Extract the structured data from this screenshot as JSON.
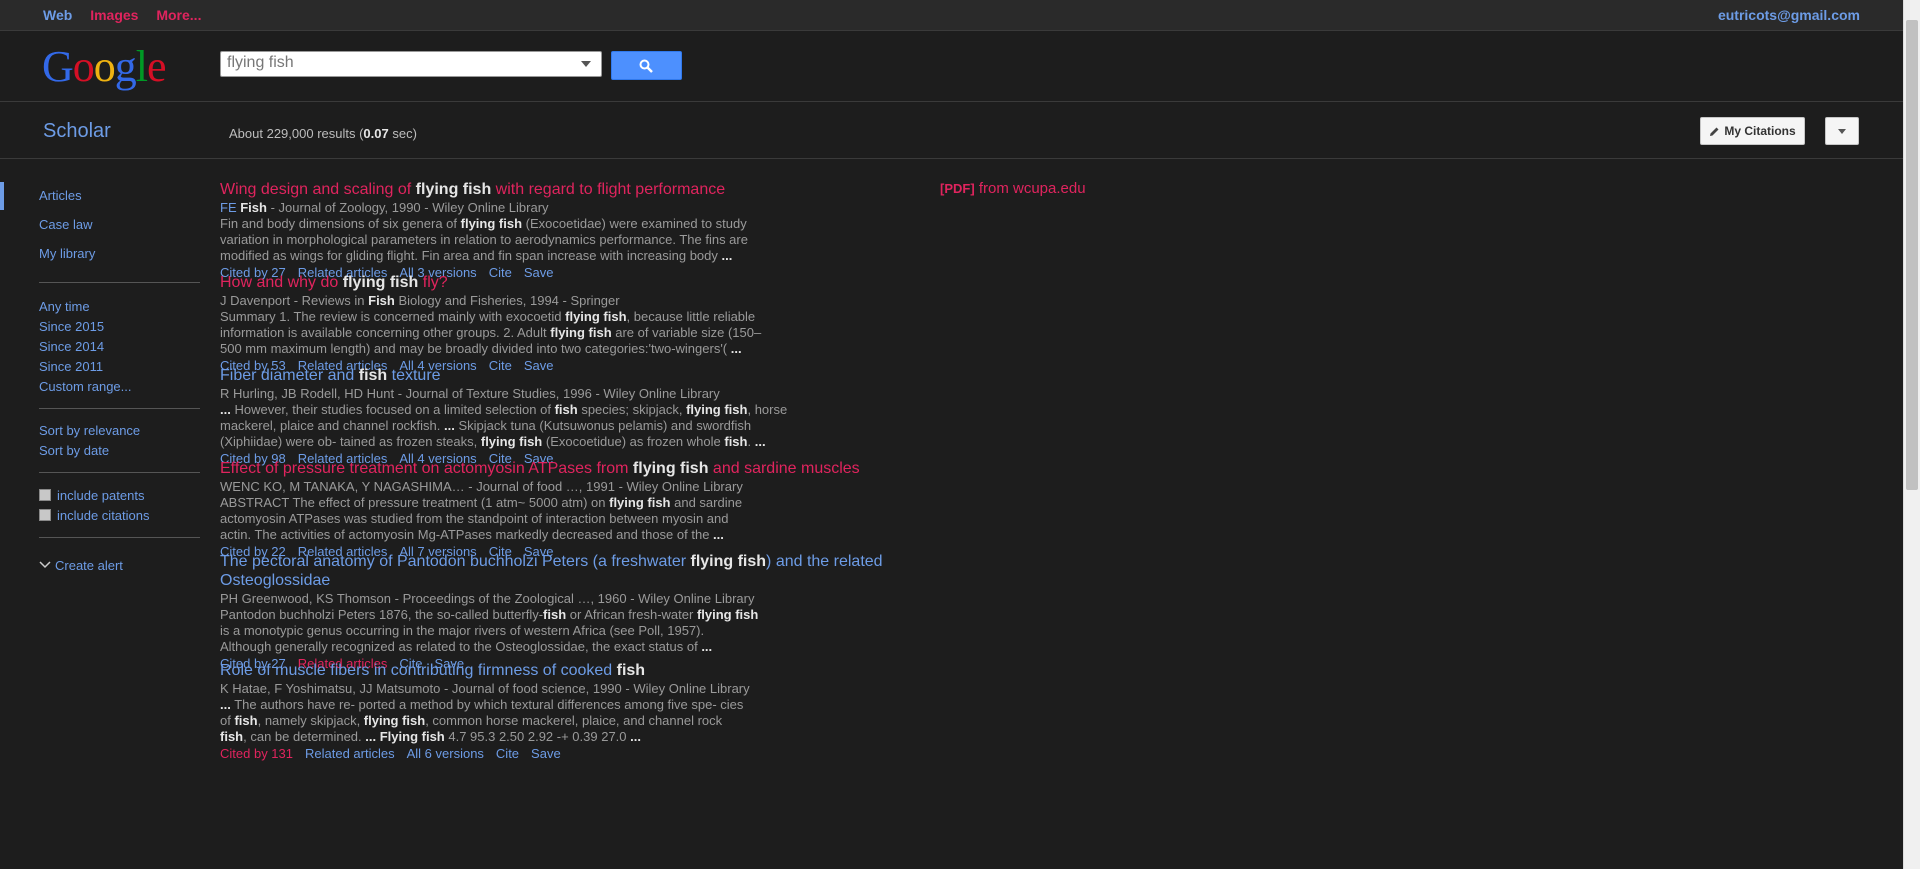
{
  "topbar": {
    "nav": [
      {
        "label": "Web",
        "color": "#6d9ce6"
      },
      {
        "label": "Images",
        "color": "#e0245e"
      },
      {
        "label": "More...",
        "color": "#e0245e"
      }
    ],
    "account": "eutricots@gmail.com"
  },
  "logo": {
    "letters": [
      {
        "ch": "G",
        "color": "#3369e8"
      },
      {
        "ch": "o",
        "color": "#d50f25"
      },
      {
        "ch": "o",
        "color": "#eeb211"
      },
      {
        "ch": "g",
        "color": "#3369e8"
      },
      {
        "ch": "l",
        "color": "#009925"
      },
      {
        "ch": "e",
        "color": "#d50f25"
      }
    ]
  },
  "search": {
    "value": "flying fish"
  },
  "scholar": {
    "title": "Scholar",
    "stats_prefix": "About 229,000 results (",
    "stats_time": "0.07",
    "stats_suffix": " sec)",
    "my_citations": "My Citations"
  },
  "sidebar": {
    "types": [
      "Articles",
      "Case law",
      "My library"
    ],
    "time": [
      "Any time",
      "Since 2015",
      "Since 2014",
      "Since 2011",
      "Custom range..."
    ],
    "sort": [
      "Sort by relevance",
      "Sort by date"
    ],
    "include": [
      "include patents",
      "include citations"
    ],
    "alert": "Create alert"
  },
  "pdf": {
    "tag": "[PDF]",
    "label": "from wcupa.edu"
  },
  "results": [
    {
      "title": [
        {
          "t": "Wing design and scaling of "
        },
        {
          "t": "flying fish",
          "b": true
        },
        {
          "t": " with regard to flight performance"
        }
      ],
      "title_color": "red",
      "authors": [
        {
          "t": "FE ",
          "c": "blue"
        },
        {
          "t": "Fish",
          "b": true
        },
        {
          "t": " - Journal of Zoology, 1990 - Wiley Online Library"
        }
      ],
      "snippet": [
        [
          {
            "t": "Fin and body dimensions of six genera of "
          },
          {
            "t": "flying fish",
            "b": true
          },
          {
            "t": " (Exocoetidae) were examined to study"
          }
        ],
        [
          {
            "t": "variation in morphological parameters in relation to aerodynamics performance. The fins are"
          }
        ],
        [
          {
            "t": "modified as wings for gliding flight. Fin area and fin span increase with increasing body "
          },
          {
            "t": "...",
            "b": true
          }
        ]
      ],
      "footer": [
        {
          "t": "Cited by 27",
          "c": "blue"
        },
        {
          "t": "Related articles",
          "c": "blue"
        },
        {
          "t": "All 3 versions",
          "c": "blue"
        },
        {
          "t": "Cite",
          "c": "blue"
        },
        {
          "t": "Save",
          "c": "blue"
        }
      ]
    },
    {
      "title": [
        {
          "t": "How and why do "
        },
        {
          "t": "flying fish",
          "b": true
        },
        {
          "t": " fly?"
        }
      ],
      "title_color": "red",
      "authors": [
        {
          "t": "J Davenport - Reviews in "
        },
        {
          "t": "Fish",
          "b": true
        },
        {
          "t": " Biology and Fisheries, 1994 - Springer"
        }
      ],
      "snippet": [
        [
          {
            "t": "Summary 1. The review is concerned mainly with exocoetid "
          },
          {
            "t": "flying fish",
            "b": true
          },
          {
            "t": ", because little reliable"
          }
        ],
        [
          {
            "t": "information is available concerning other groups. 2. Adult "
          },
          {
            "t": "flying fish",
            "b": true
          },
          {
            "t": " are of variable size (150–"
          }
        ],
        [
          {
            "t": "500 mm maximum length) and may be broadly divided into two categories:'two-wingers'( "
          },
          {
            "t": "...",
            "b": true
          }
        ]
      ],
      "footer": [
        {
          "t": "Cited by 53",
          "c": "blue"
        },
        {
          "t": "Related articles",
          "c": "blue"
        },
        {
          "t": "All 4 versions",
          "c": "blue"
        },
        {
          "t": "Cite",
          "c": "blue"
        },
        {
          "t": "Save",
          "c": "blue"
        }
      ]
    },
    {
      "title": [
        {
          "t": "Fiber diameter and "
        },
        {
          "t": "fish",
          "b": true
        },
        {
          "t": " texture"
        }
      ],
      "title_color": "blue",
      "authors": [
        {
          "t": "R Hurling, JB Rodell, HD Hunt - Journal of Texture Studies, 1996 - Wiley Online Library"
        }
      ],
      "snippet": [
        [
          {
            "t": "...",
            "b": true
          },
          {
            "t": " However, their studies focused on a limited selection of "
          },
          {
            "t": "fish",
            "b": true
          },
          {
            "t": " species; skipjack, "
          },
          {
            "t": "flying fish",
            "b": true
          },
          {
            "t": ", horse"
          }
        ],
        [
          {
            "t": "mackerel, plaice and channel rockfish. "
          },
          {
            "t": "...",
            "b": true
          },
          {
            "t": " Skipjack tuna (Kutsuwonus pelamis) and swordfish"
          }
        ],
        [
          {
            "t": "(Xiphiidae) were ob- tained as frozen steaks, "
          },
          {
            "t": "flying fish",
            "b": true
          },
          {
            "t": " (Exocoetidue) as frozen whole "
          },
          {
            "t": "fish",
            "b": true
          },
          {
            "t": ". "
          },
          {
            "t": "...",
            "b": true
          }
        ]
      ],
      "footer": [
        {
          "t": "Cited by 98",
          "c": "blue"
        },
        {
          "t": "Related articles",
          "c": "blue"
        },
        {
          "t": "All 4 versions",
          "c": "blue"
        },
        {
          "t": "Cite",
          "c": "blue"
        },
        {
          "t": "Save",
          "c": "blue"
        }
      ]
    },
    {
      "title": [
        {
          "t": "Effect of pressure treatment on actomyosin ATPases from "
        },
        {
          "t": "flying fish",
          "b": true
        },
        {
          "t": " and sardine muscles"
        }
      ],
      "title_color": "red",
      "authors": [
        {
          "t": "WENC KO, M TANAKA, Y NAGASHIMA… - Journal of food …, 1991 - Wiley Online Library"
        }
      ],
      "snippet": [
        [
          {
            "t": "ABSTRACT The effect of pressure treatment (1 atm~ 5000 atm) on "
          },
          {
            "t": "flying fish",
            "b": true
          },
          {
            "t": " and sardine"
          }
        ],
        [
          {
            "t": "actomyosin ATPases was studied from the standpoint of interaction between myosin and"
          }
        ],
        [
          {
            "t": "actin. The activities of actomyosin Mg-ATPases markedly decreased and those of the "
          },
          {
            "t": "...",
            "b": true
          }
        ]
      ],
      "footer": [
        {
          "t": "Cited by 22",
          "c": "blue"
        },
        {
          "t": "Related articles",
          "c": "blue"
        },
        {
          "t": "All 7 versions",
          "c": "blue"
        },
        {
          "t": "Cite",
          "c": "blue"
        },
        {
          "t": "Save",
          "c": "blue"
        }
      ]
    },
    {
      "title": [
        {
          "t": "The pectoral anatomy of Pantodon buchholzi Peters (a freshwater "
        },
        {
          "t": "flying fish",
          "b": true
        },
        {
          "t": ") and the related Osteoglossidae"
        }
      ],
      "title_color": "blue",
      "authors": [
        {
          "t": "PH Greenwood, KS Thomson - Proceedings of the Zoological …, 1960 - Wiley Online Library"
        }
      ],
      "snippet": [
        [
          {
            "t": "Pantodon buchholzi Peters 1876, the so-called butterfly-"
          },
          {
            "t": "fish",
            "b": true
          },
          {
            "t": " or African fresh-water "
          },
          {
            "t": "flying fish",
            "b": true
          }
        ],
        [
          {
            "t": "is a monotypic genus occurring in the major rivers of western Africa (see Poll, 1957)."
          }
        ],
        [
          {
            "t": "Although generally recognized as related to the Osteoglossidae, the exact status of "
          },
          {
            "t": "...",
            "b": true
          }
        ]
      ],
      "footer": [
        {
          "t": "Cited by 27",
          "c": "blue"
        },
        {
          "t": "Related articles",
          "c": "red"
        },
        {
          "t": "Cite",
          "c": "blue"
        },
        {
          "t": "Save",
          "c": "blue"
        }
      ]
    },
    {
      "title": [
        {
          "t": "Role of muscle fibers in contributing firmness of cooked "
        },
        {
          "t": "fish",
          "b": true
        }
      ],
      "title_color": "blue",
      "authors": [
        {
          "t": "K Hatae, F Yoshimatsu, JJ Matsumoto - Journal of food science, 1990 - Wiley Online Library"
        }
      ],
      "snippet": [
        [
          {
            "t": "...",
            "b": true
          },
          {
            "t": " The authors have re- ported a method by which textural differences among five spe- cies"
          }
        ],
        [
          {
            "t": "of "
          },
          {
            "t": "fish",
            "b": true
          },
          {
            "t": ", namely skipjack, "
          },
          {
            "t": "flying fish",
            "b": true
          },
          {
            "t": ", common horse mackerel, plaice, and channel rock"
          }
        ],
        [
          {
            "t": "fish",
            "b": true
          },
          {
            "t": ", can be determined. "
          },
          {
            "t": "...",
            "b": true
          },
          {
            "t": " "
          },
          {
            "t": "Flying fish",
            "b": true
          },
          {
            "t": " 4.7 95.3 2.50 2.92 -+ 0.39 27.0 "
          },
          {
            "t": "...",
            "b": true
          }
        ]
      ],
      "footer": [
        {
          "t": "Cited by 131",
          "c": "red"
        },
        {
          "t": "Related articles",
          "c": "blue"
        },
        {
          "t": "All 6 versions",
          "c": "blue"
        },
        {
          "t": "Cite",
          "c": "blue"
        },
        {
          "t": "Save",
          "c": "blue"
        }
      ]
    }
  ]
}
